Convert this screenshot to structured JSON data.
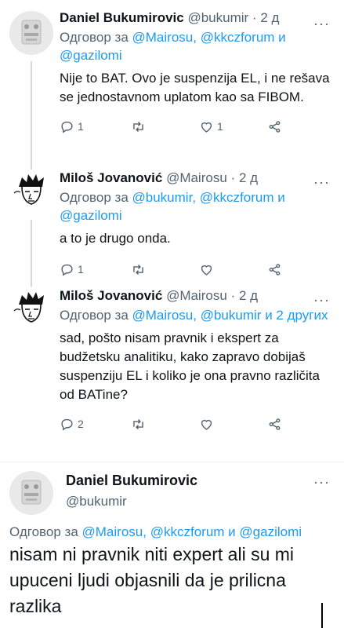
{
  "tweets": [
    {
      "name": "Daniel Bukumirovic",
      "handle": "@bukumir",
      "dot": "·",
      "time": "2 д",
      "reply_prefix": "Одговор за",
      "mention1": "@Mairosu",
      "sep": ",",
      "mention2": "@kkczforum",
      "and": "и",
      "mention3": "@gazilomi",
      "text": "Nije to BAT. Ovo je suspenzija EL, i ne rešava se jednostavnom uplatom kao sa FIBOM.",
      "reply_count": "1",
      "retweet_count": "",
      "like_count": "1"
    },
    {
      "name": "Miloš Jovanović",
      "handle": "@Mairosu",
      "dot": "·",
      "time": "2 д",
      "reply_prefix": "Одговор за",
      "mention1": "@bukumir",
      "sep": ",",
      "mention2": "@kkczforum",
      "and": "и",
      "mention3": "@gazilomi",
      "text": "a to je drugo onda.",
      "reply_count": "1",
      "retweet_count": "",
      "like_count": ""
    },
    {
      "name": "Miloš Jovanović",
      "handle": "@Mairosu",
      "dot": "·",
      "time": "2 д",
      "reply_prefix": "Одговор за",
      "mention1": "@Mairosu",
      "sep": ",",
      "mention2": "@bukumir",
      "and": "и",
      "mention3": "2 других",
      "text": "sad, pošto nisam pravnik i ekspert za budžetsku analitiku, kako zapravo dobijaš suspenziju EL i koliko je ona pravno različita od BATine?",
      "reply_count": "2",
      "retweet_count": "",
      "like_count": ""
    }
  ],
  "main": {
    "name": "Daniel Bukumirovic",
    "handle": "@bukumir",
    "reply_prefix": "Одговор за",
    "mention1": "@Mairosu",
    "sep": ",",
    "mention2": "@kkczforum",
    "and": "и",
    "mention3": "@gazilomi",
    "text": "nisam ni pravnik niti expert ali su mi upuceni ljudi objasnili da je prilicna razlika"
  },
  "more_label": "···",
  "icons": [
    "reply-icon",
    "retweet-icon",
    "like-icon",
    "share-icon",
    "more-icon"
  ],
  "colors": {
    "accent": "#1d9bf0",
    "muted": "#536471",
    "text": "#0f1419"
  }
}
